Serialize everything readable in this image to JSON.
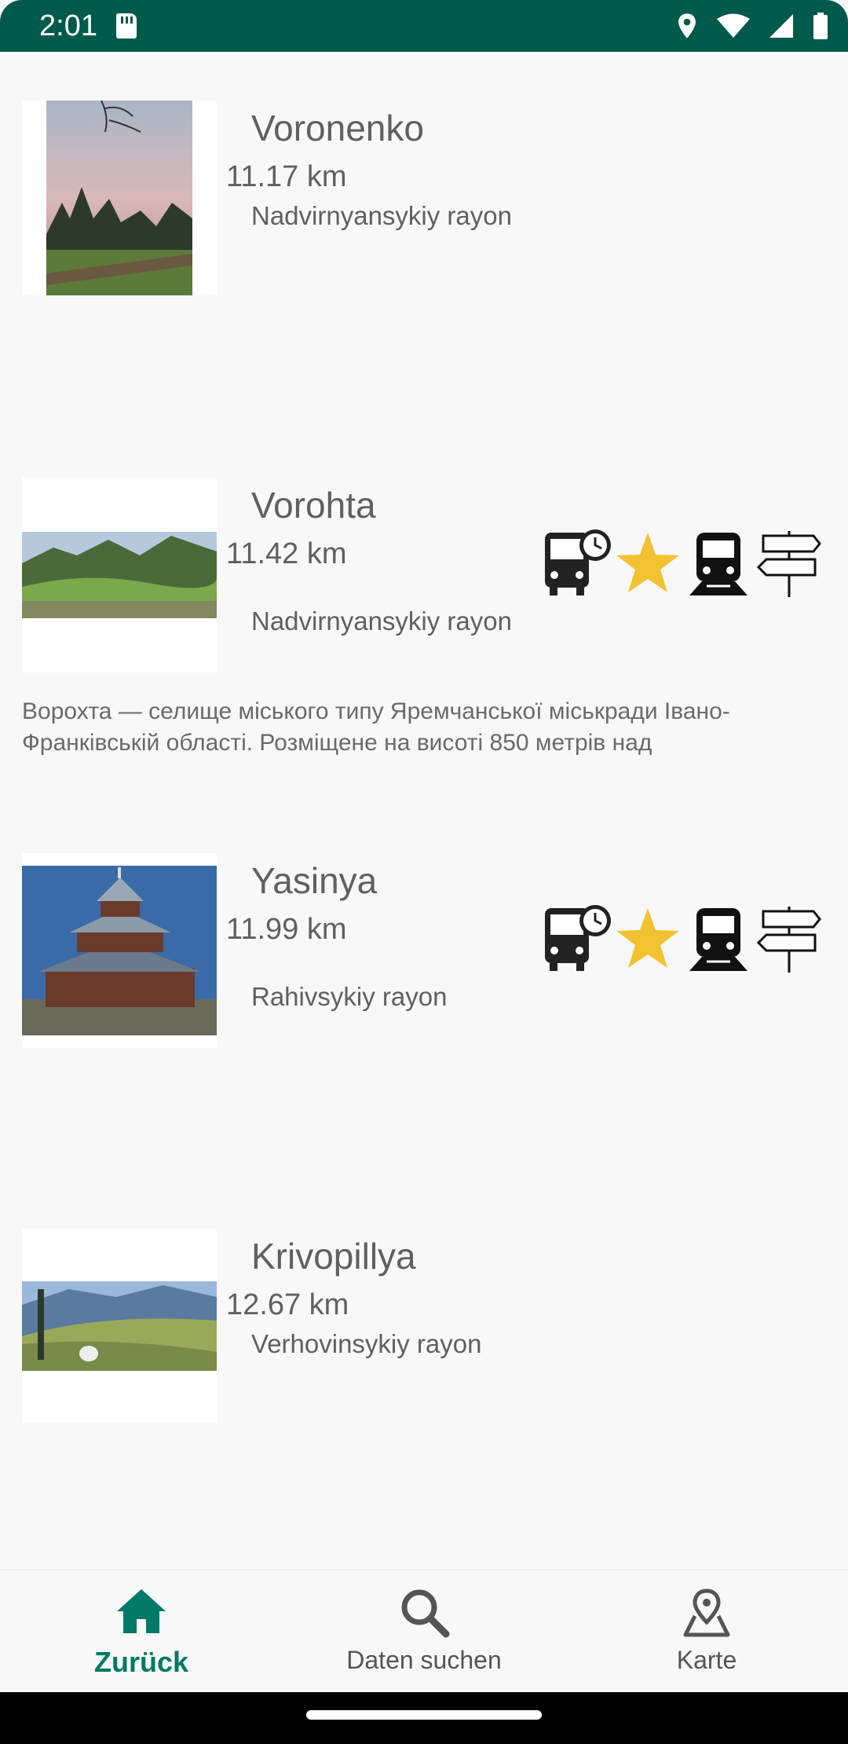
{
  "status_bar": {
    "time": "2:01",
    "icons": [
      "sd-card-icon",
      "location-icon",
      "wifi-icon",
      "signal-icon",
      "battery-icon"
    ]
  },
  "places": [
    {
      "name": "Voronenko",
      "distance": "11.17 km",
      "region": "Nadvirnyansykiy rayon",
      "description": "",
      "has_features": false
    },
    {
      "name": "Vorohta",
      "distance": "11.42 km",
      "region": "Nadvirnyansykiy rayon",
      "description": "Ворохта — селище міського типу Яремчанської міськради Івано-Франківській області. Розміщене на висоті 850 метрів над",
      "has_features": true
    },
    {
      "name": "Yasinya",
      "distance": "11.99 km",
      "region": "Rahivsykiy rayon",
      "description": "",
      "has_features": true
    },
    {
      "name": "Krivopillya",
      "distance": "12.67 km",
      "region": "Verhovinsykiy rayon",
      "description": "",
      "has_features": false
    }
  ],
  "feature_icons": [
    "bus-schedule-icon",
    "star-icon",
    "train-icon",
    "signpost-icon"
  ],
  "bottom_nav": {
    "items": [
      {
        "label": "Zurück",
        "icon": "home-icon",
        "active": true
      },
      {
        "label": "Daten suchen",
        "icon": "search-icon",
        "active": false
      },
      {
        "label": "Karte",
        "icon": "map-pin-icon",
        "active": false
      }
    ]
  },
  "colors": {
    "status_bar": "#005a4b",
    "accent": "#007a66",
    "star": "#f2c230",
    "background": "#f8f8f8"
  }
}
